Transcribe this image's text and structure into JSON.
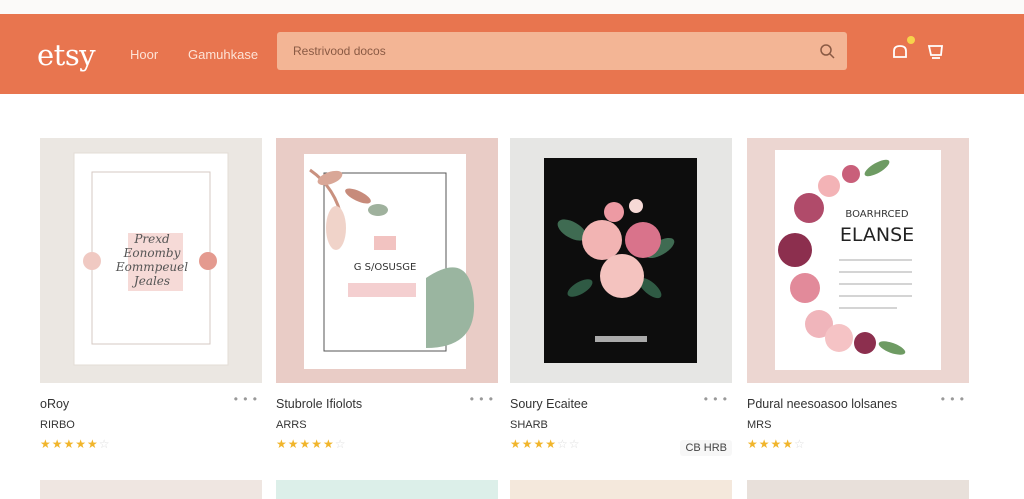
{
  "header": {
    "logo": "etsy",
    "nav": [
      "Hoor",
      "Gamuhkase"
    ],
    "search_placeholder": "Restrivood docos"
  },
  "colors": {
    "header": "#e8754f",
    "stars": "#f1b52b"
  },
  "products": [
    {
      "title": "oRoy",
      "price": "RIRBO",
      "rating": 5,
      "design_text": [
        "Prexd",
        "Eonomby",
        "Eommpeuel",
        "Jeales"
      ]
    },
    {
      "title": "Stubrole Ifiolots",
      "price": "ARRS",
      "rating": 5,
      "design_text": [
        "G S/OSUSGE"
      ]
    },
    {
      "title": "Soury Ecaitee",
      "price": "SHARB",
      "rating": 3,
      "badge": "CB HRB",
      "design_text": []
    },
    {
      "title": "Pdural neesoasoo lolsanes",
      "price": "MRS",
      "rating": 4,
      "design_text": [
        "BOARHRCED",
        "ELANSE"
      ]
    }
  ]
}
